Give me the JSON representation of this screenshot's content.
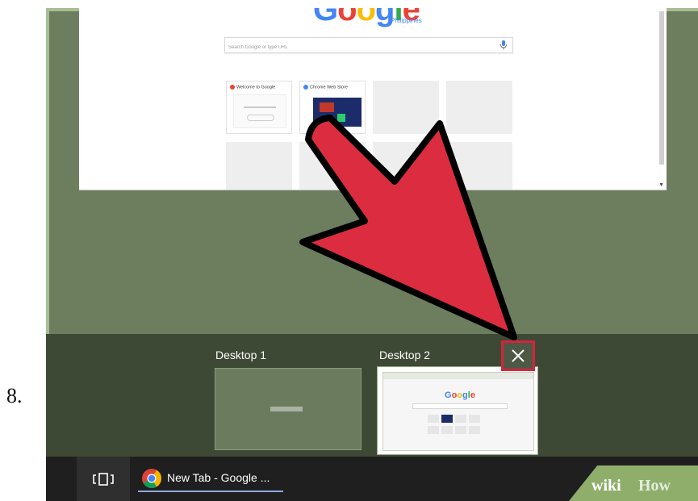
{
  "step_number": "8.",
  "browser_preview": {
    "logo_text": "Google",
    "logo_country": "Philippines",
    "search_placeholder": "Search Google or type URL",
    "tiles": [
      {
        "title": "Welcome to Google"
      },
      {
        "title": "Chrome Web Store"
      }
    ]
  },
  "task_view": {
    "desktops": [
      {
        "label": "Desktop 1"
      },
      {
        "label": "Desktop 2",
        "mini_logo": "Google"
      }
    ],
    "close_icon": "close-icon"
  },
  "taskbar": {
    "task_view_icon": "task-view-icon",
    "app_icon": "chrome-icon",
    "app_label": "New Tab - Google ..."
  },
  "watermark": {
    "wiki": "wiki",
    "how": "How"
  },
  "colors": {
    "arrow": "#dc2d40",
    "highlight": "#d7233e",
    "task_strip": "#3e4935",
    "desktop_bg": "#6d7e5f",
    "taskbar": "#1f1f1f"
  }
}
